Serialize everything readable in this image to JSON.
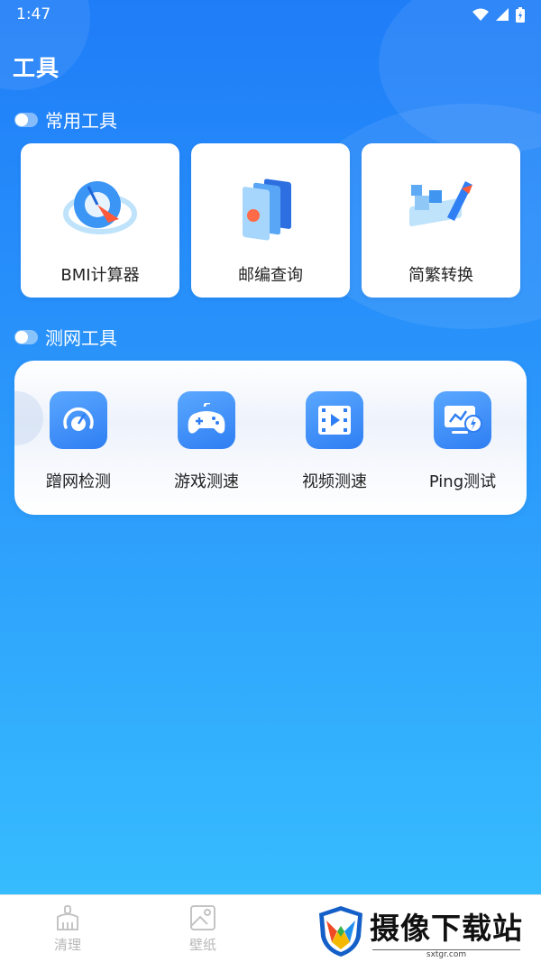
{
  "status_bar": {
    "time": "1:47"
  },
  "page": {
    "title": "工具"
  },
  "common_tools": {
    "header": "常用工具",
    "items": [
      {
        "label": "BMI计算器",
        "icon": "bmi-calculator-icon"
      },
      {
        "label": "邮编查询",
        "icon": "postcode-query-icon"
      },
      {
        "label": "简繁转换",
        "icon": "simplified-traditional-convert-icon"
      }
    ]
  },
  "network_tools": {
    "header": "测网工具",
    "items": [
      {
        "label": "蹭网检测",
        "icon": "speedometer-icon"
      },
      {
        "label": "游戏测速",
        "icon": "gamepad-icon"
      },
      {
        "label": "视频测速",
        "icon": "video-icon"
      },
      {
        "label": "Ping测试",
        "icon": "monitor-ping-icon"
      }
    ]
  },
  "bottom_nav": {
    "items": [
      {
        "label": "清理",
        "icon": "broom-icon"
      },
      {
        "label": "壁纸",
        "icon": "wallpaper-icon"
      }
    ]
  },
  "watermark": {
    "title": "摄像下载站",
    "subtitle": "sxtgr.com"
  },
  "colors": {
    "accent": "#2f7ef3",
    "background_top": "#1f7df8",
    "background_bottom": "#38c1ff"
  }
}
